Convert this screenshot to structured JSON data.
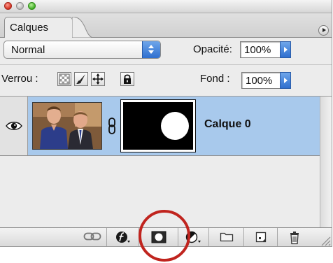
{
  "window": {
    "close_icon": "close-icon",
    "minimize_icon": "minimize-icon",
    "zoom_icon": "zoom-icon"
  },
  "tabs": [
    {
      "label": "Calques",
      "active": true
    }
  ],
  "panel_menu_icon": "panel-menu-icon",
  "blend": {
    "mode": "Normal",
    "opacity_label": "Opacité:",
    "opacity_value": "100%"
  },
  "lock": {
    "label": "Verrou :",
    "icons": [
      "lock-transparency-icon",
      "lock-image-icon",
      "lock-position-icon",
      "lock-all-icon"
    ],
    "fill_label": "Fond :",
    "fill_value": "100%"
  },
  "layers": [
    {
      "name": "Calque 0",
      "visible": true,
      "selected": true,
      "has_mask": true
    }
  ],
  "bottom_toolbar": {
    "buttons": [
      "link-layers-icon",
      "layer-style-icon",
      "add-mask-icon",
      "adjustment-layer-icon",
      "new-group-icon",
      "new-layer-icon",
      "trash-icon"
    ],
    "highlighted": "add-mask-icon"
  },
  "colors": {
    "selection": "#a8c9ec",
    "panel": "#ececec",
    "accent_blue": "#2f6fcf",
    "annotation_red": "#c0241e"
  }
}
